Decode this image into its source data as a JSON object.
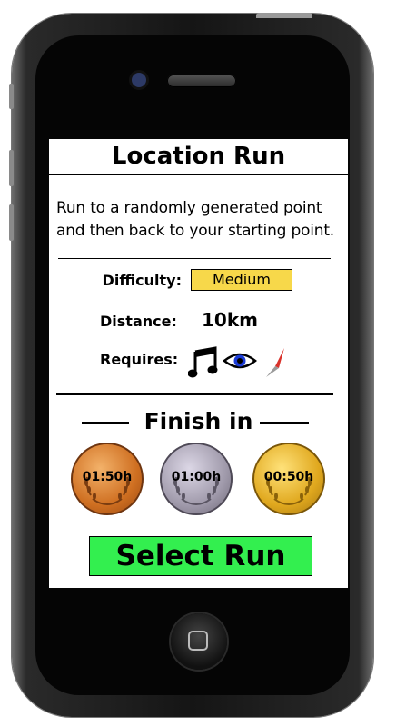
{
  "screen": {
    "title": "Location Run",
    "description_line1": "Run to a randomly generated point",
    "description_line2": "and then back to your starting point.",
    "difficulty_label": "Difficulty:",
    "difficulty_value": "Medium",
    "distance_label": "Distance:",
    "distance_value": "10km",
    "requires_label": "Requires:",
    "requires_icons": [
      "music-note-icon",
      "eye-icon",
      "compass-needle-icon"
    ],
    "finish_heading": "Finish in",
    "medals": [
      {
        "type": "bronze",
        "time": "01:50h"
      },
      {
        "type": "silver",
        "time": "01:00h"
      },
      {
        "type": "gold",
        "time": "00:50h"
      }
    ],
    "select_button_label": "Select Run"
  },
  "colors": {
    "difficulty_badge": "#f7d84a",
    "select_button": "#33ef4f",
    "bronze": "#cf6f21",
    "silver": "#a09aab",
    "gold": "#e0a81e"
  }
}
